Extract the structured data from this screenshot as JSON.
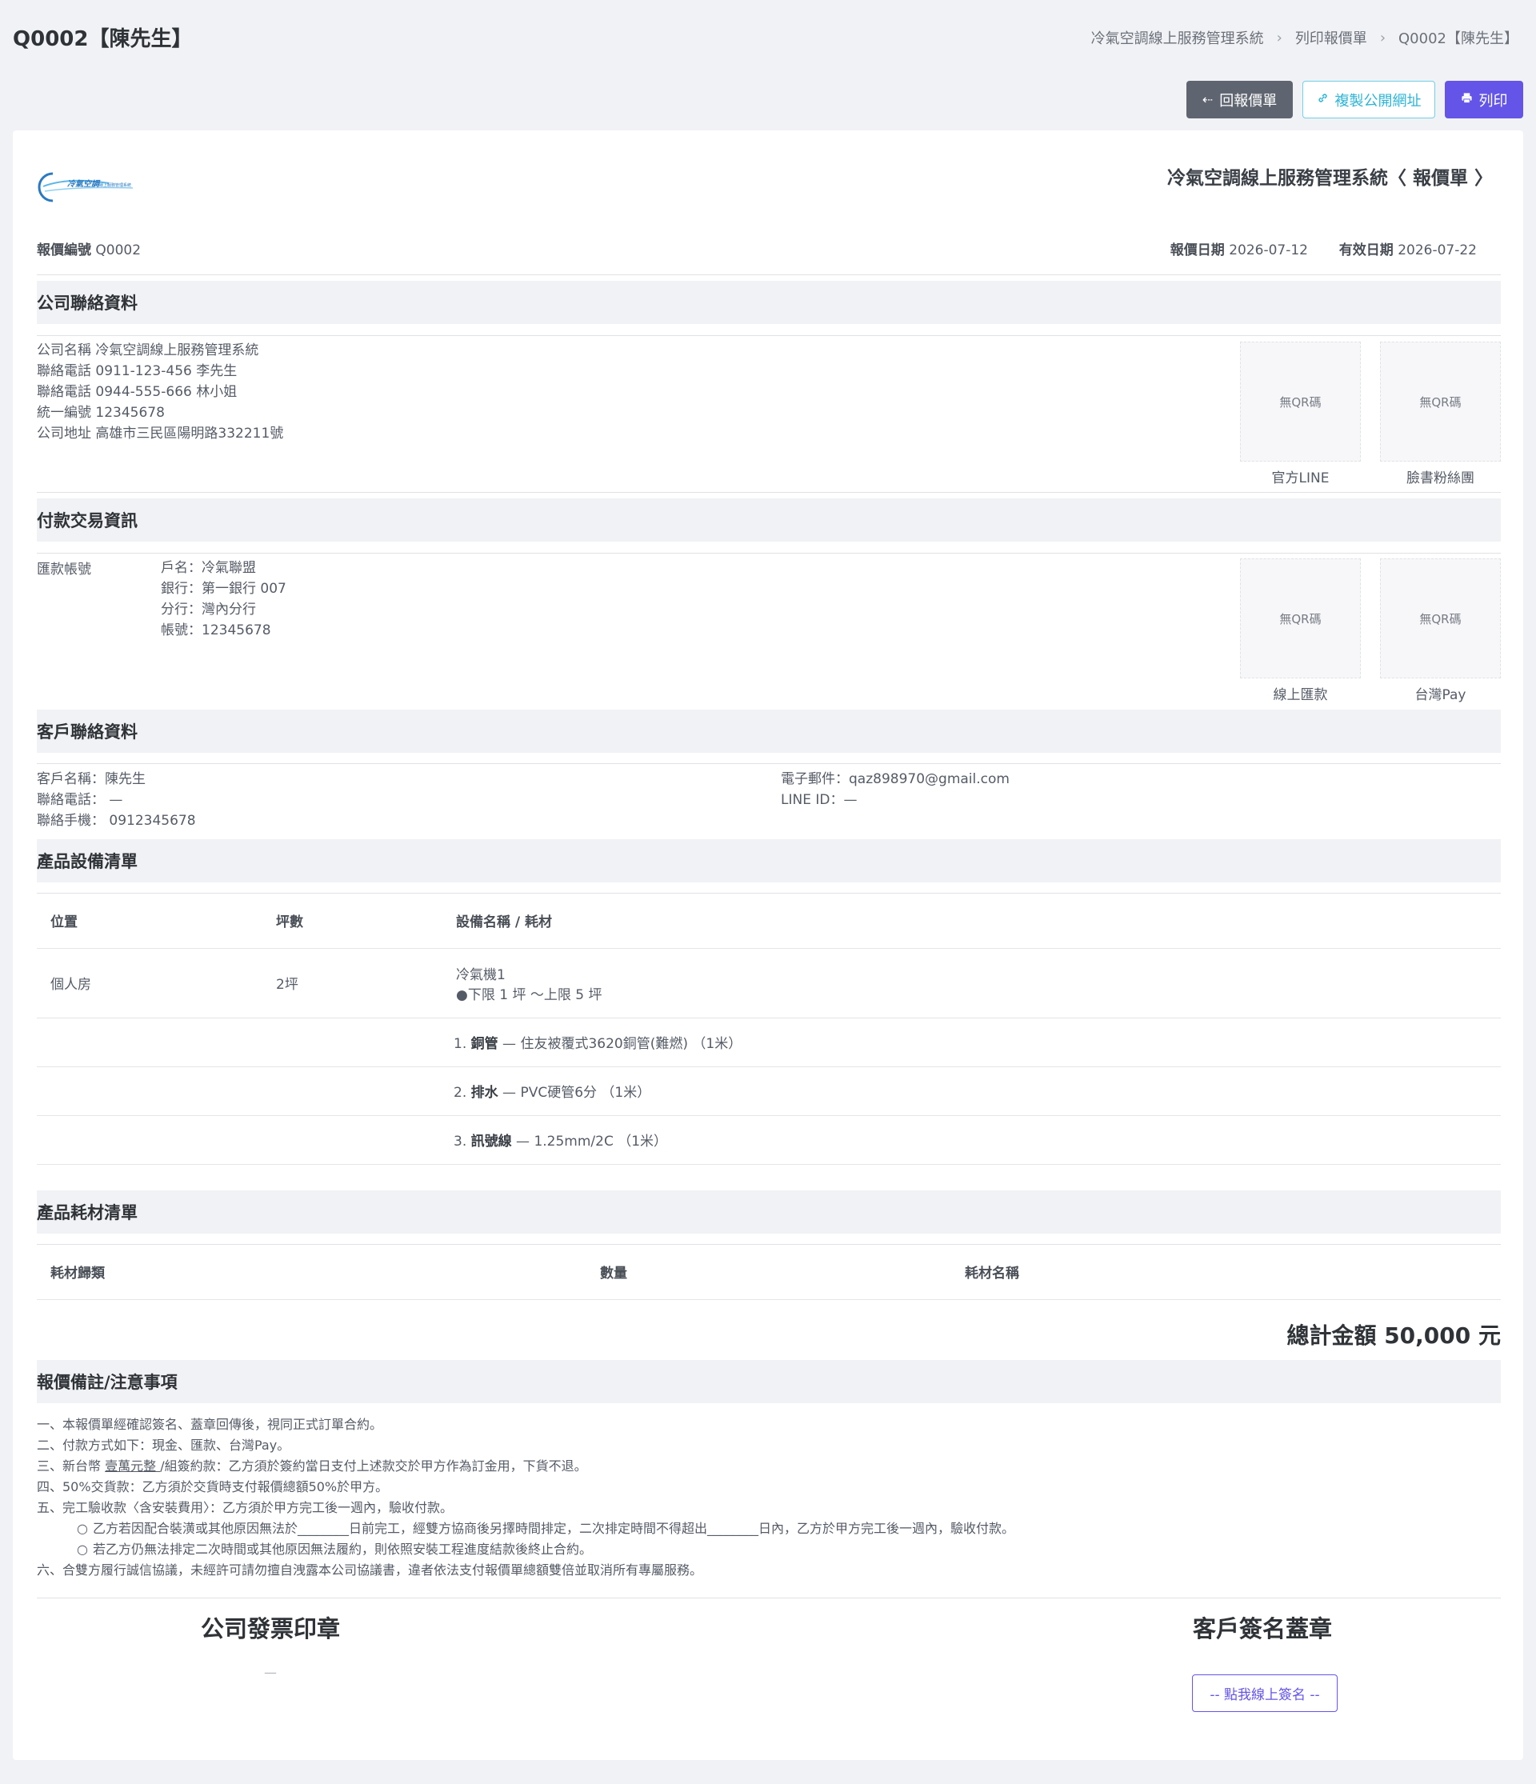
{
  "page": {
    "title": "Q0002【陳先生】"
  },
  "breadcrumb": {
    "items": [
      "冷氣空調線上服務管理系統",
      "列印報價單",
      "Q0002【陳先生】"
    ],
    "separator": "›"
  },
  "toolbar": {
    "back_label": "回報價單",
    "copy_label": "複製公開網址",
    "print_label": "列印"
  },
  "doc": {
    "logo_text": "冷氣空調",
    "logo_subtext": "線上服務管理系統",
    "title": "冷氣空調線上服務管理系統〈 報價單 〉",
    "quote_no_label": "報價編號",
    "quote_no": "Q0002",
    "quote_date_label": "報價日期",
    "quote_date": "2026-07-12",
    "valid_date_label": "有效日期",
    "valid_date": "2026-07-22"
  },
  "company": {
    "heading": "公司聯絡資料",
    "lines": [
      "公司名稱 冷氣空調線上服務管理系統",
      "聯絡電話 0911-123-456 李先生",
      "聯絡電話 0944-555-666 林小姐",
      "統一編號 12345678",
      "公司地址 高雄市三民區陽明路332211號"
    ],
    "qr": [
      {
        "text": "無QR碼",
        "caption": "官方LINE"
      },
      {
        "text": "無QR碼",
        "caption": "臉書粉絲團"
      }
    ]
  },
  "payment": {
    "heading": "付款交易資訊",
    "label": "匯款帳號",
    "lines": [
      "戶名：冷氣聯盟",
      "銀行：第一銀行 007",
      "分行：灣內分行",
      "帳號：12345678"
    ],
    "qr": [
      {
        "text": "無QR碼",
        "caption": "線上匯款"
      },
      {
        "text": "無QR碼",
        "caption": "台灣Pay"
      }
    ]
  },
  "customer": {
    "heading": "客戶聯絡資料",
    "left": [
      "客戶名稱：陳先生",
      "聯絡電話： —",
      "聯絡手機： 0912345678"
    ],
    "right": [
      "電子郵件：qaz898970@gmail.com",
      "LINE ID：—"
    ]
  },
  "equipment": {
    "heading": "產品設備清單",
    "headers": [
      "位置",
      "坪數",
      "設備名稱 / 耗材"
    ],
    "row": {
      "location": "個人房",
      "size": "2坪",
      "name": "冷氣機1",
      "range": "●下限 1 坪 ～上限 5 坪"
    },
    "subitems": [
      {
        "num": "1.",
        "name": "銅管",
        "desc": "— 住友被覆式3620銅管(難燃) （1米）"
      },
      {
        "num": "2.",
        "name": "排水",
        "desc": "— PVC硬管6分 （1米）"
      },
      {
        "num": "3.",
        "name": "訊號線",
        "desc": "— 1.25mm/2C （1米）"
      }
    ]
  },
  "materials": {
    "heading": "產品耗材清單",
    "headers": [
      "耗材歸類",
      "數量",
      "耗材名稱"
    ]
  },
  "total": {
    "label": "總計金額 50,000 元"
  },
  "notes": {
    "heading": "報價備註/注意事項",
    "l1": "一、本報價單經確認簽名、蓋章回傳後，視同正式訂單合約。",
    "l2": "二、付款方式如下：現金、匯款、台灣Pay。",
    "l3a": "三、新台幣 ",
    "l3u": " 壹萬元整 ",
    "l3b": " /組簽約款：乙方須於簽約當日支付上述款交於甲方作為訂金用，下貨不退。",
    "l4": "四、50%交貨款：乙方須於交貨時支付報價總額50%於甲方。",
    "l5": "五、完工驗收款〈含安裝費用〉：乙方須於甲方完工後一週內，驗收付款。",
    "l5a": "乙方若因配合裝潢或其他原因無法於________日前完工，經雙方協商後另擇時間排定，二次排定時間不得超出________日內，乙方於甲方完工後一週內，驗收付款。",
    "l5b": "若乙方仍無法排定二次時間或其他原因無法履約，則依照安裝工程進度結款後終止合約。",
    "l6": "六、合雙方履行誠信協議，未經許可請勿擅自洩露本公司協議書，違者依法支付報價單總額雙倍並取消所有專屬服務。",
    "bullet": "○"
  },
  "signature": {
    "company_heading": "公司發票印章",
    "company_value": "—",
    "customer_heading": "客戶簽名蓋章",
    "sign_button": "-- 點我線上簽名 --"
  }
}
